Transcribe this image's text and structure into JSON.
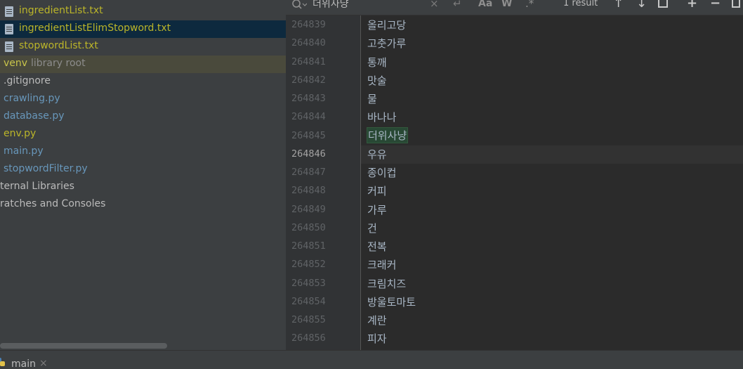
{
  "project_tree": {
    "items": [
      {
        "label": "ingredientList.txt",
        "kind": "file",
        "color": "#bbb529"
      },
      {
        "label": "ingredientListElimStopword.txt",
        "kind": "file",
        "color": "#bbb529",
        "selected": true
      },
      {
        "label": "stopwordList.txt",
        "kind": "file",
        "color": "#bbb529"
      },
      {
        "label": "venv",
        "kind": "folder",
        "suffix": "library root"
      },
      {
        "label": ".gitignore",
        "kind": "file"
      },
      {
        "label": "crawling.py",
        "kind": "python"
      },
      {
        "label": "database.py",
        "kind": "python"
      },
      {
        "label": "env.py",
        "kind": "python"
      },
      {
        "label": "main.py",
        "kind": "python"
      },
      {
        "label": "stopwordFilter.py",
        "kind": "python"
      },
      {
        "label": "ternal Libraries",
        "kind": "node"
      },
      {
        "label": "ratches and Consoles",
        "kind": "node"
      }
    ]
  },
  "search": {
    "query": "더위사냥",
    "match_case_label": "Aa",
    "whole_word_label": "W",
    "regex_label": ".*",
    "result_count": "1 result"
  },
  "editor": {
    "current_line": "264846",
    "lines": [
      {
        "no": "264839",
        "text": "올리고당"
      },
      {
        "no": "264840",
        "text": "고춧가루"
      },
      {
        "no": "264841",
        "text": "통깨"
      },
      {
        "no": "264842",
        "text": "맛술"
      },
      {
        "no": "264843",
        "text": "물"
      },
      {
        "no": "264844",
        "text": "바나나"
      },
      {
        "no": "264845",
        "text": "더위사냥",
        "match": true
      },
      {
        "no": "264846",
        "text": "우유"
      },
      {
        "no": "264847",
        "text": "종이컵"
      },
      {
        "no": "264848",
        "text": "커피"
      },
      {
        "no": "264849",
        "text": "가루"
      },
      {
        "no": "264850",
        "text": "건"
      },
      {
        "no": "264851",
        "text": "전복"
      },
      {
        "no": "264852",
        "text": "크래커"
      },
      {
        "no": "264853",
        "text": "크림치즈"
      },
      {
        "no": "264854",
        "text": "방울토마토"
      },
      {
        "no": "264855",
        "text": "계란"
      },
      {
        "no": "264856",
        "text": "피자"
      }
    ]
  },
  "run_panel": {
    "tab_label": "main",
    "close_glyph": "×"
  },
  "colors": {
    "file_yellow": "#bbb529",
    "python_blue": "#6897bb",
    "selection": "#0d293e",
    "match_bg": "#284834"
  }
}
